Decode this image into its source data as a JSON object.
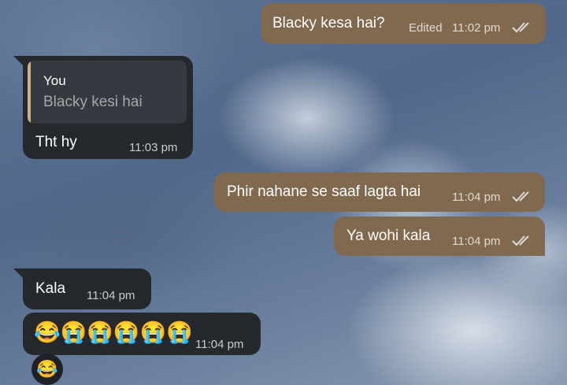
{
  "messages": [
    {
      "direction": "out",
      "text": "Blacky kesa hai?",
      "edited": "Edited",
      "time": "11:02 pm",
      "status_icon": "double-check-icon"
    },
    {
      "direction": "in",
      "reply_to": {
        "name": "You",
        "text": "Blacky kesi hai"
      },
      "text": "Tht hy",
      "time": "11:03 pm"
    },
    {
      "direction": "out",
      "text": "Phir nahane se saaf lagta hai",
      "time": "11:04 pm",
      "status_icon": "double-check-icon"
    },
    {
      "direction": "out",
      "text": "Ya wohi kala",
      "time": "11:04 pm",
      "status_icon": "double-check-icon"
    },
    {
      "direction": "in",
      "text": "Kala",
      "time": "11:04 pm"
    },
    {
      "direction": "in",
      "text": "😂😭😭😭😭😭",
      "emojis": [
        "😂",
        "😭",
        "😭",
        "😭",
        "😭",
        "😭"
      ],
      "time": "11:04 pm"
    }
  ],
  "avatar": {
    "emoji": "😂"
  },
  "colors": {
    "outgoing_bubble": "#80694f",
    "incoming_bubble": "#25292e",
    "reply_bar": "#c8b28a"
  }
}
